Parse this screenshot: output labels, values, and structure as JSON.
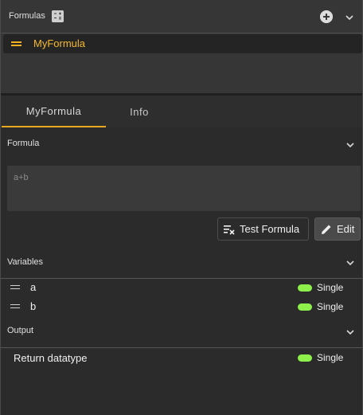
{
  "formulas_panel": {
    "title": "Formulas",
    "items": [
      {
        "label": "MyFormula",
        "selected": true
      }
    ]
  },
  "tabs": [
    {
      "label": "MyFormula",
      "active": true
    },
    {
      "label": "Info",
      "active": false
    }
  ],
  "formula_section": {
    "title": "Formula",
    "expression": "a+b",
    "test_button_label": "Test Formula",
    "edit_button_label": "Edit"
  },
  "variables_section": {
    "title": "Variables",
    "items": [
      {
        "name": "a",
        "datatype": "Single"
      },
      {
        "name": "b",
        "datatype": "Single"
      }
    ]
  },
  "output_section": {
    "title": "Output",
    "return_label": "Return datatype",
    "datatype": "Single"
  },
  "colors": {
    "accent": "#f5b82e",
    "datatype_pill": "#8ef04a",
    "background": "#2b2b2b",
    "panel": "#363636"
  },
  "icons": {
    "calculator": "calculator-icon",
    "add": "add-circle-icon",
    "collapse": "chevron-down-icon",
    "drag": "drag-handle-icon",
    "test": "playlist-check-icon",
    "edit": "pencil-icon"
  }
}
